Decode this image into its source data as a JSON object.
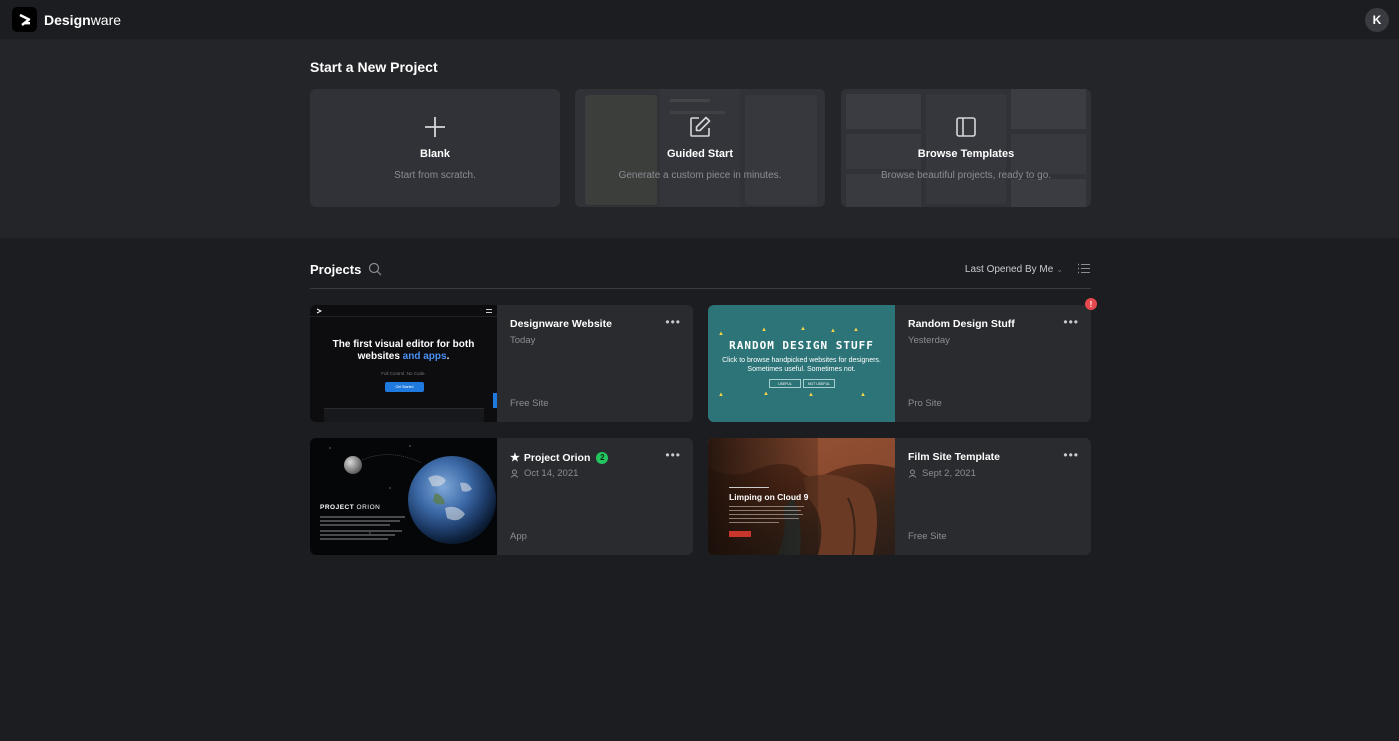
{
  "app": {
    "brand_bold": "Design",
    "brand_light": "ware",
    "avatar_initial": "K"
  },
  "new_project": {
    "title": "Start a New Project",
    "cards": [
      {
        "label": "Blank",
        "subtitle": "Start from scratch.",
        "icon": "plus-icon"
      },
      {
        "label": "Guided Start",
        "subtitle": "Generate a custom piece in minutes.",
        "icon": "edit-icon"
      },
      {
        "label": "Browse Templates",
        "subtitle": "Browse beautiful projects, ready to go.",
        "icon": "layout-icon"
      }
    ]
  },
  "projects": {
    "title": "Projects",
    "sort_label": "Last Opened By Me",
    "items": [
      {
        "name": "Designware Website",
        "date": "Today",
        "type": "Free Site",
        "thumb": {
          "headline_1": "The first visual editor for both",
          "headline_2a": "websites ",
          "headline_2b": "and apps",
          "headline_2c": ".",
          "subtitle": "Full Control. No Code.",
          "button": "Get Started"
        }
      },
      {
        "name": "Random Design Stuff",
        "date": "Yesterday",
        "type": "Pro Site",
        "badge": "!",
        "thumb": {
          "title": "RANDOM DESIGN STUFF",
          "subtitle_1": "Click to browse handpicked websites for designers.",
          "subtitle_2": "Sometimes useful. Sometimes not.",
          "button_1": "USEFUL",
          "button_2": "NOT USEFUL"
        }
      },
      {
        "name": "Project Orion",
        "date": "Oct 14, 2021",
        "type": "App",
        "badge": "2",
        "starred": true,
        "thumb": {
          "title_bold": "PROJECT",
          "title_light": " ORION"
        }
      },
      {
        "name": "Film Site Template",
        "date": "Sept 2, 2021",
        "type": "Free Site",
        "thumb": {
          "title": "Limping on Cloud 9"
        }
      }
    ]
  },
  "colors": {
    "background": "#1c1d21",
    "panel": "#242529",
    "card": "#2a2b2f",
    "accent_blue": "#4a90f5",
    "badge_green": "#22c55e",
    "badge_red": "#e5484d"
  }
}
